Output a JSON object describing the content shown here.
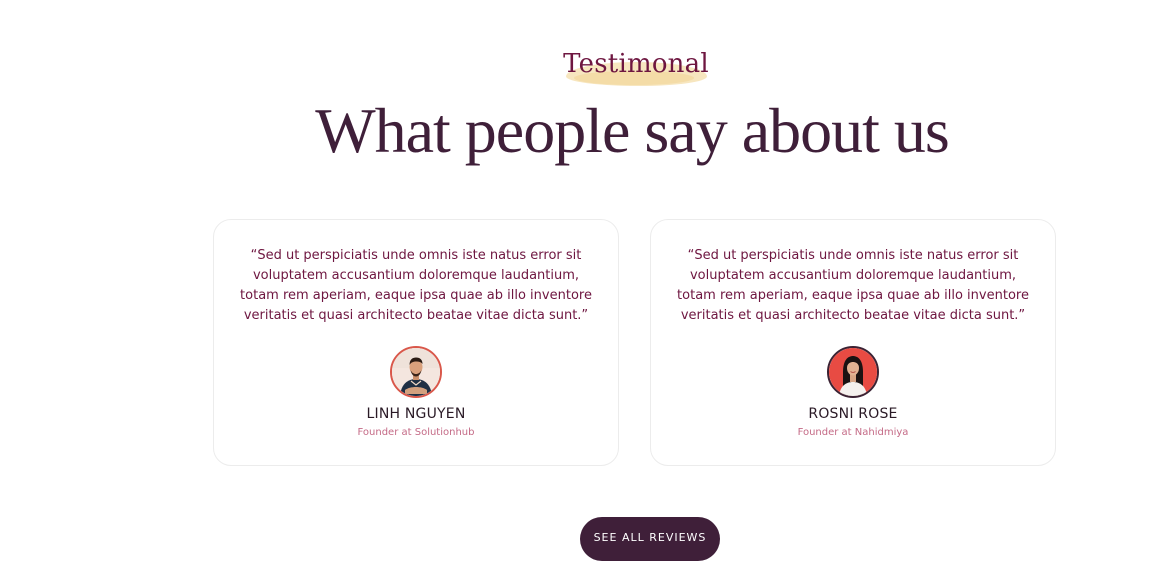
{
  "section": {
    "eyebrow": "Testimonal",
    "heading": "What people say about us"
  },
  "testimonials": [
    {
      "quote": "“Sed ut perspiciatis unde omnis iste natus error sit voluptatem accusantium doloremque laudantium, totam rem aperiam, eaque ipsa quae ab illo inventore veritatis et quasi architecto beatae vitae dicta sunt.”",
      "name": "LINH NGUYEN",
      "role": "Founder at Solutionhub"
    },
    {
      "quote": "“Sed ut perspiciatis unde omnis iste natus error sit voluptatem accusantium doloremque laudantium, totam rem aperiam, eaque ipsa quae ab illo inventore veritatis et quasi architecto beatae vitae dicta sunt.”",
      "name": "ROSNI ROSE",
      "role": "Founder at Nahidmiya"
    }
  ],
  "cta": {
    "label": "SEE ALL REVIEWS"
  },
  "colors": {
    "heading": "#3f1f39",
    "accent": "#6e1640",
    "highlight": "#f6e3b8",
    "button": "#3f1f39"
  }
}
